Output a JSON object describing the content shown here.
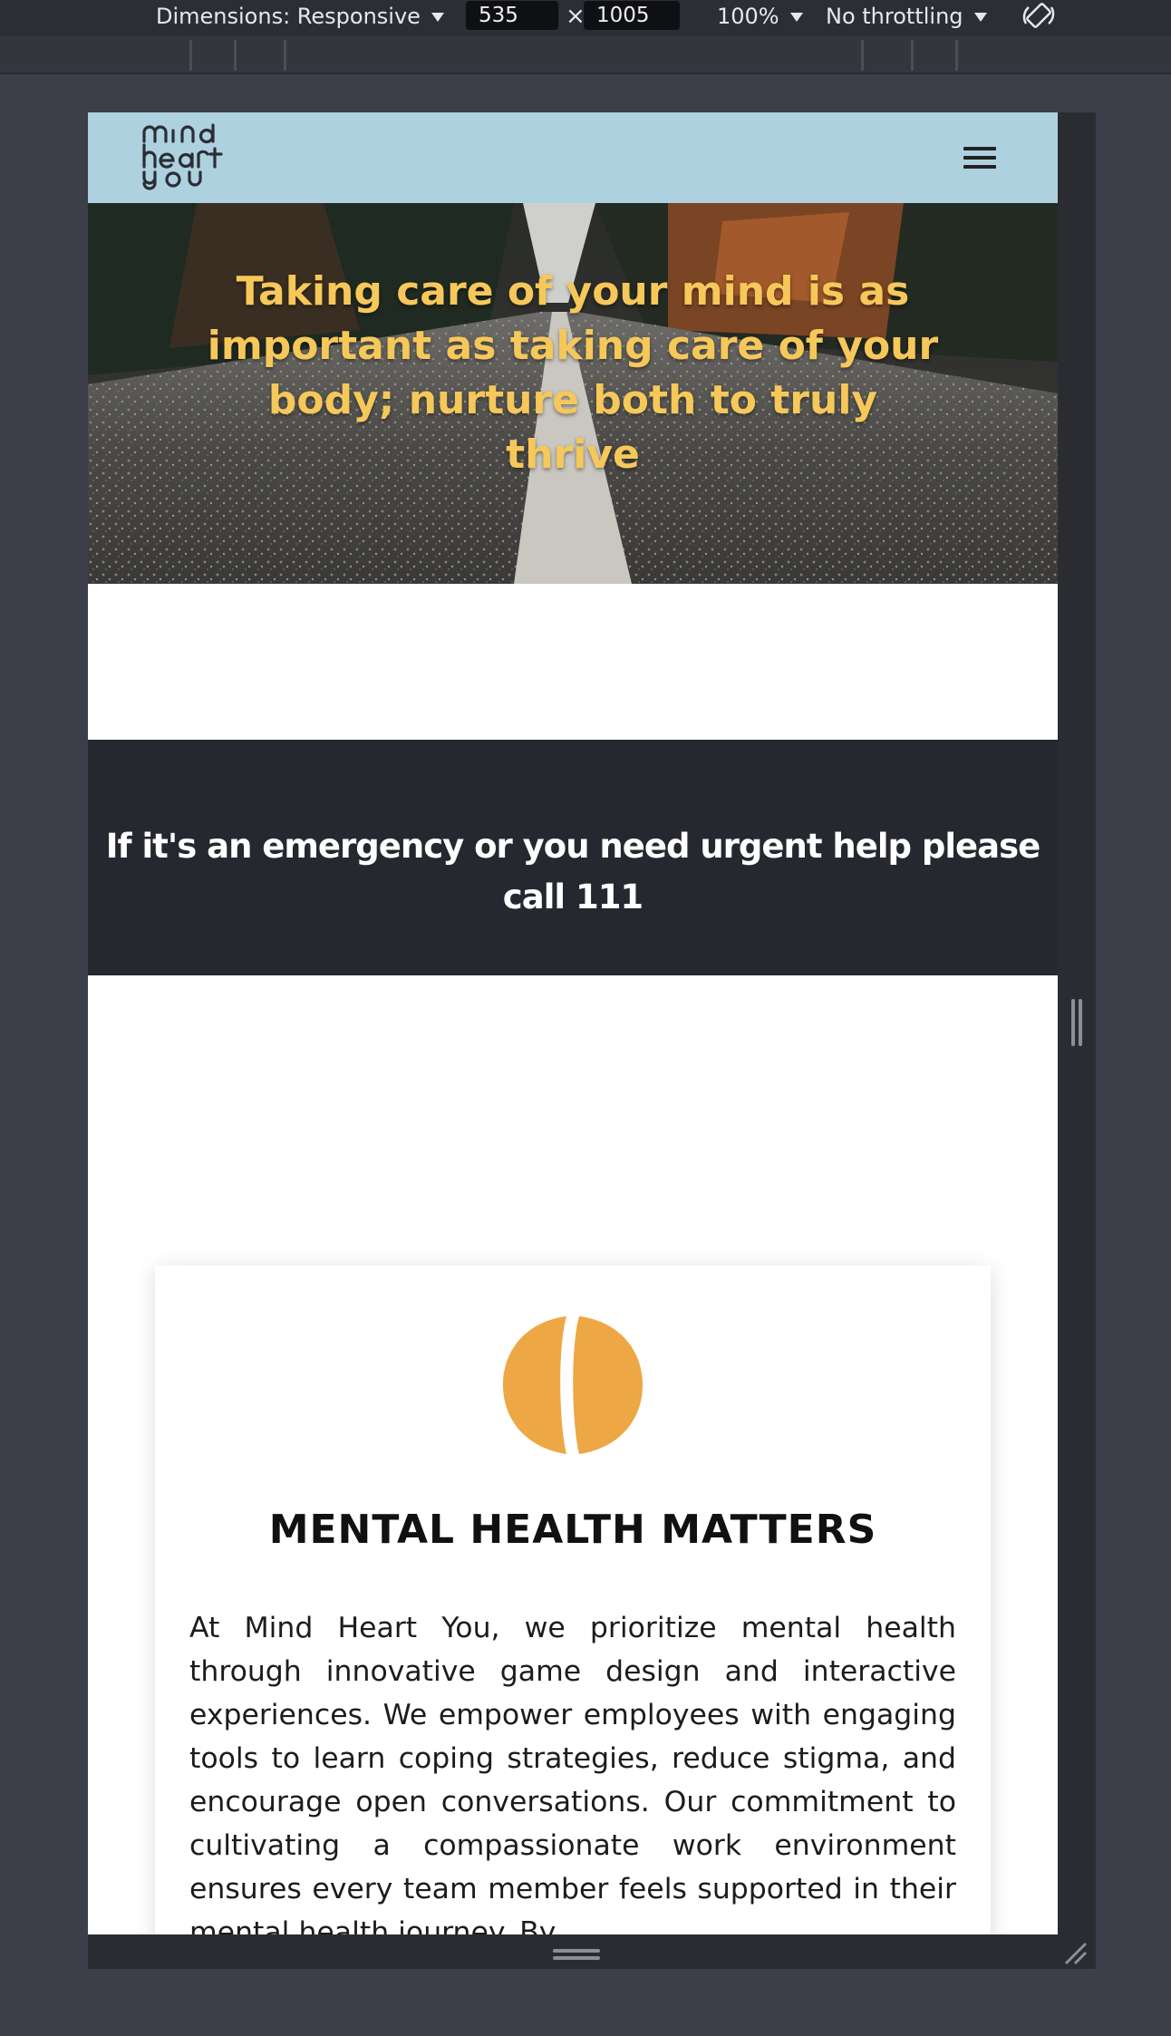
{
  "devtools": {
    "dimensions_label": "Dimensions: Responsive",
    "width_value": "535",
    "times_symbol": "×",
    "height_value": "1005",
    "zoom_label": "100%",
    "throttling_label": "No throttling"
  },
  "site": {
    "logo": [
      "mind",
      "heart",
      "you"
    ],
    "hero_quote": "Taking care of your mind is as important as taking care of your body; nurture both to truly thrive",
    "emergency_text": "If it's an emergency or you need urgent help please call 111",
    "card": {
      "icon": "brain-icon",
      "title": "MENTAL HEALTH MATTERS",
      "body": "At Mind Heart You, we prioritize mental health through innovative game design and interactive experiences. We empower employees with engaging tools to learn coping strategies, reduce stigma, and encourage open conversations. Our commitment to cultivating a compassionate work environment ensures every team member feels supported in their mental health journey. By"
    }
  },
  "colors": {
    "header_bg": "#aed1df",
    "hero_text": "#f6c85a",
    "emergency_bg": "#262830",
    "brain_icon": "#eda744"
  }
}
